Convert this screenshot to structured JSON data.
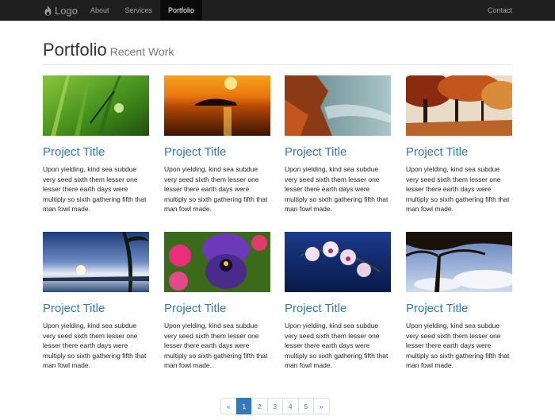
{
  "nav": {
    "brand": "Logo",
    "items": [
      {
        "label": "About",
        "active": false
      },
      {
        "label": "Services",
        "active": false
      },
      {
        "label": "Portfolio",
        "active": true
      }
    ],
    "right": "Contact"
  },
  "header": {
    "title": "Portfolio",
    "subtitle": "Recent Work"
  },
  "projects": [
    {
      "title": "Project Title",
      "text": "Upon yielding, kind sea subdue very seed sixth them lesser one lesser there earth days were multiply so sixth gathering fifth that man fowl made.",
      "image": "green-grass-ant-photo"
    },
    {
      "title": "Project Title",
      "text": "Upon yielding, kind sea subdue very seed sixth them lesser one lesser there earth days were multiply so sixth gathering fifth that man fowl made.",
      "image": "sunset-island-photo"
    },
    {
      "title": "Project Title",
      "text": "Upon yielding, kind sea subdue very seed sixth them lesser one lesser there earth days were multiply so sixth gathering fifth that man fowl made.",
      "image": "coast-rocks-photo"
    },
    {
      "title": "Project Title",
      "text": "Upon yielding, kind sea subdue very seed sixth them lesser one lesser there earth days were multiply so sixth gathering fifth that man fowl made.",
      "image": "autumn-trees-photo"
    },
    {
      "title": "Project Title",
      "text": "Upon yielding, kind sea subdue very seed sixth them lesser one lesser there earth days were multiply so sixth gathering fifth that man fowl made.",
      "image": "palm-beach-sunset-photo"
    },
    {
      "title": "Project Title",
      "text": "Upon yielding, kind sea subdue very seed sixth them lesser one lesser there earth days were multiply so sixth gathering fifth that man fowl made.",
      "image": "pansy-flower-photo"
    },
    {
      "title": "Project Title",
      "text": "Upon yielding, kind sea subdue very seed sixth them lesser one lesser there earth days were multiply so sixth gathering fifth that man fowl made.",
      "image": "orchid-photo"
    },
    {
      "title": "Project Title",
      "text": "Upon yielding, kind sea subdue very seed sixth them lesser one lesser there earth days were multiply so sixth gathering fifth that man fowl made.",
      "image": "tree-silhouette-sky-photo"
    }
  ],
  "pagination": {
    "prev": "«",
    "pages": [
      "1",
      "2",
      "3",
      "4",
      "5"
    ],
    "active": "1",
    "next": "»"
  },
  "colors": {
    "navbar": "#1f1f1f",
    "link": "#337ab7",
    "active_page": "#337ab7"
  }
}
